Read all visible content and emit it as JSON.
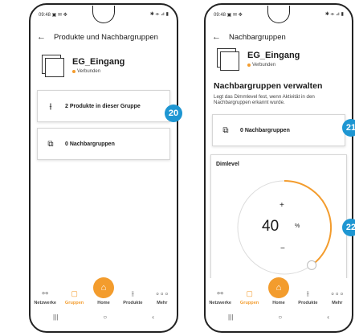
{
  "colors": {
    "accent": "#f39c2d",
    "badge": "#1e96d2"
  },
  "screen1": {
    "status": {
      "time": "09:48 ▣ ✉ ✥",
      "icons": "✱ ⌯ ⊿ ▮"
    },
    "title": "Produkte und Nachbargruppen",
    "group": {
      "name": "EG_Eingang",
      "status": "Verbunden"
    },
    "cards": [
      {
        "icon": "sliders-icon",
        "glyph": "⫲",
        "label": "2 Produkte in dieser Gruppe"
      },
      {
        "icon": "copy-icon",
        "glyph": "⧉",
        "label": "0 Nachbargruppen"
      }
    ],
    "badge": "20"
  },
  "screen2": {
    "status": {
      "time": "09:48 ▣ ✉ ✥",
      "icons": "✱ ⌯ ⊿ ▮"
    },
    "title": "Nachbargruppen",
    "group": {
      "name": "EG_Eingang",
      "status": "Verbunden"
    },
    "section_title": "Nachbargruppen verwalten",
    "section_desc": "Legt das Dimmlevel fest, wenn Aktivität in den Nachbargruppen erkannt wurde.",
    "card": {
      "icon": "copy-icon",
      "glyph": "⧉",
      "label": "0 Nachbargruppen"
    },
    "dimlevel": {
      "label": "Dimlevel",
      "value": "40",
      "unit": "%",
      "plus": "+",
      "minus": "−",
      "percent": 40
    },
    "badges": [
      "21",
      "22"
    ]
  },
  "nav": [
    {
      "icon": "network-icon",
      "glyph": "⚯",
      "label": "Netzwerke"
    },
    {
      "icon": "groups-icon",
      "glyph": "▢",
      "label": "Gruppen"
    },
    {
      "icon": "home-icon",
      "glyph": "⌂",
      "label": "Home"
    },
    {
      "icon": "products-icon",
      "glyph": "⫲",
      "label": "Produkte"
    },
    {
      "icon": "more-icon",
      "glyph": "∘∘∘",
      "label": "Mehr"
    }
  ],
  "gestures": {
    "recent": "|||",
    "home": "○",
    "back": "‹"
  }
}
